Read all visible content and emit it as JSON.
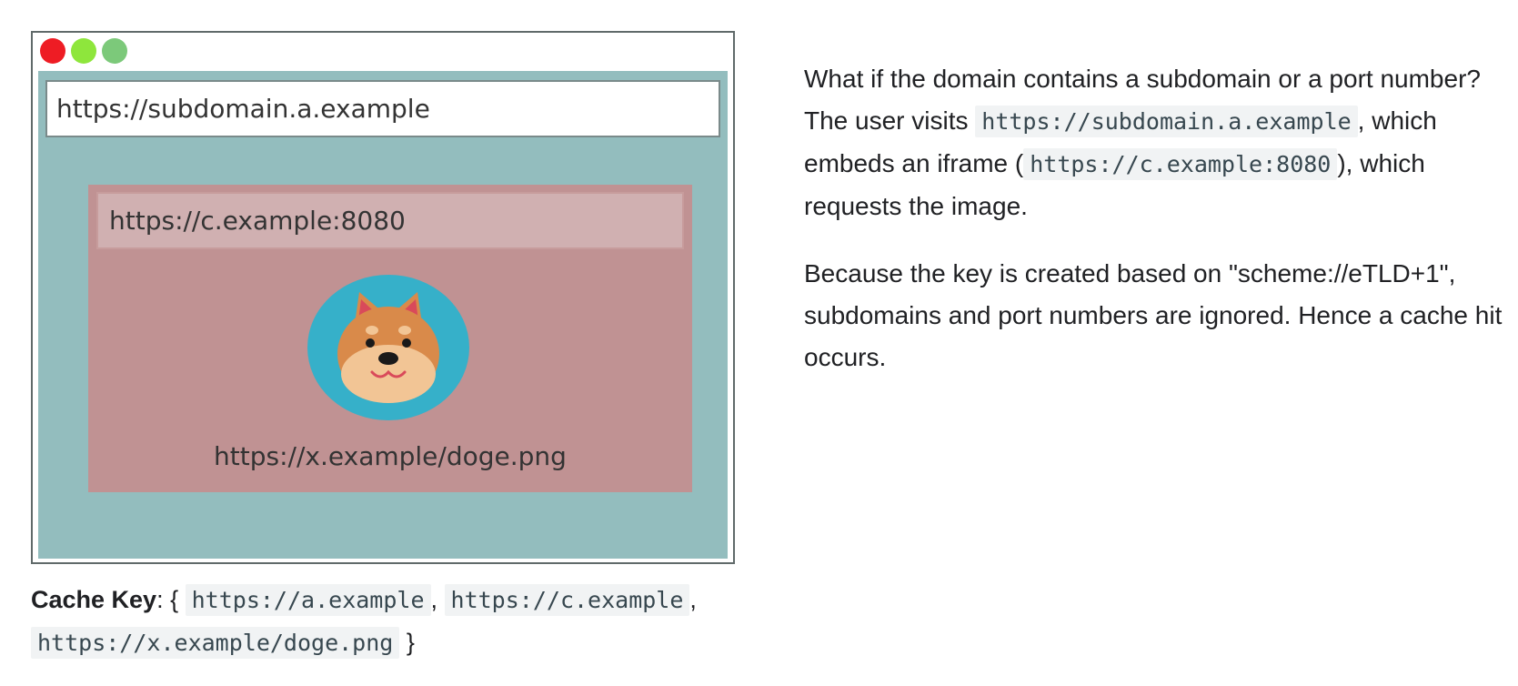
{
  "colors": {
    "close": "#ee1c24",
    "minimize": "#8ee63c",
    "maximize": "#7cc97a",
    "viewport_bg": "#93bdbe",
    "iframe_bg": "#c09293",
    "iframe_url_bg": "#d0b0b1",
    "doge_circle": "#36b0c9"
  },
  "browser": {
    "top_url": "https://subdomain.a.example",
    "iframe_url": "https://c.example:8080",
    "image_url": "https://x.example/doge.png",
    "image_icon": "doge-icon"
  },
  "caption": {
    "label": "Cache Key",
    "sep": ": {",
    "key1": "https://a.example",
    "comma1": ",",
    "key2": "https://c.example",
    "comma2": ",",
    "key3": "https://x.example/doge.png",
    "close": "}"
  },
  "text": {
    "p1_a": "What if the domain contains a subdomain or a port number? The user visits",
    "p1_code1": "https://subdomain.a.example",
    "p1_b": ", which embeds an iframe (",
    "p1_code2": "https://c.example:8080",
    "p1_c": "), which requests the image.",
    "p2": "Because the key is created based on \"scheme://eTLD+1\", subdomains and port numbers are ignored. Hence a cache hit occurs."
  }
}
